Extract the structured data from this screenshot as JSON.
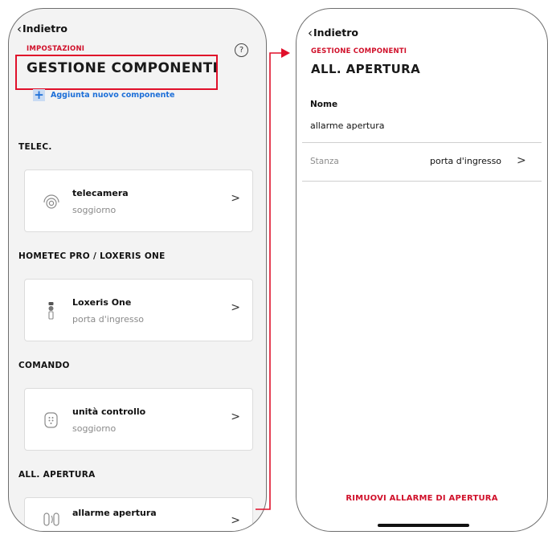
{
  "left_screen": {
    "back_label": "Indietro",
    "eyebrow": "IMPOSTAZIONI",
    "title": "GESTIONE COMPONENTI",
    "help_icon_glyph": "?",
    "add_icon_glyph": "+",
    "add_label": "Aggiunta nuovo componente",
    "sections": [
      {
        "title": "TELEC.",
        "item": {
          "name": "telecamera",
          "room": "soggiorno",
          "icon": "camera-icon"
        }
      },
      {
        "title": "HOMETEC PRO / LOXERIS ONE",
        "item": {
          "name": "Loxeris One",
          "room": "porta d'ingresso",
          "icon": "door-lock-icon"
        }
      },
      {
        "title": "COMANDO",
        "item": {
          "name": "unità controllo",
          "room": "soggiorno",
          "icon": "keypad-icon"
        }
      },
      {
        "title": "ALL. APERTURA",
        "item": {
          "name": "allarme apertura",
          "room": "",
          "icon": "opening-sensor-icon"
        }
      }
    ],
    "arrow_glyph": ">"
  },
  "right_screen": {
    "back_label": "Indietro",
    "eyebrow": "GESTIONE COMPONENTI",
    "title": "ALL. APERTURA",
    "name_label": "Nome",
    "name_value": "allarme apertura",
    "room_label": "Stanza",
    "room_value": "porta d'ingresso",
    "arrow_glyph": ">",
    "remove_label": "RIMUOVI ALLARME DI APERTURA"
  },
  "colors": {
    "accent_red": "#d0102a",
    "link_blue": "#1d6fd8",
    "screen_bg": "#f3f3f3",
    "highlight": "#e0102a"
  }
}
